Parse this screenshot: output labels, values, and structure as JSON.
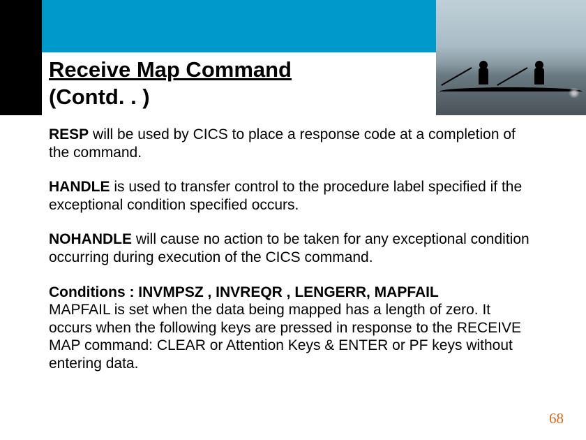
{
  "title_line1": "Receive Map Command",
  "title_line2": "(Contd. . )",
  "para1_bold": "RESP",
  "para1_rest": " will be used by CICS to place a response code at a completion of the command.",
  "para2_bold": "HANDLE",
  "para2_rest": " is used to transfer control to the procedure label specified if the exceptional condition specified occurs.",
  "para3_bold": "NOHANDLE",
  "para3_rest": " will cause no action to be taken for any exceptional condition occurring during execution of the CICS command.",
  "para4_bold": "Conditions : INVMPSZ , INVREQR , LENGERR,  MAPFAIL",
  "para4_rest": "MAPFAIL is set when the data being mapped has a length of zero. It occurs when the following keys are pressed in response to the RECEIVE MAP command: CLEAR or Attention Keys & ENTER or PF keys without entering data.",
  "page_number": "68"
}
